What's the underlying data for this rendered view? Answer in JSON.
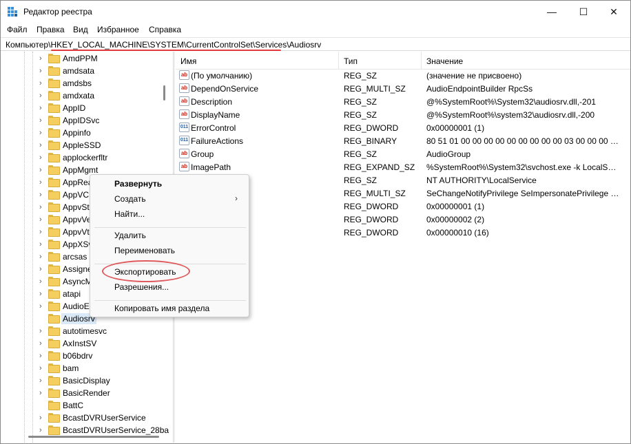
{
  "window": {
    "title": "Редактор реестра",
    "minimize": "—",
    "maximize": "☐",
    "close": "✕"
  },
  "menu": [
    "Файл",
    "Правка",
    "Вид",
    "Избранное",
    "Справка"
  ],
  "address": {
    "path": "Компьютер\\HKEY_LOCAL_MACHINE\\SYSTEM\\CurrentControlSet\\Services\\Audiosrv"
  },
  "tree": [
    {
      "label": "AmdPPM",
      "expandable": true
    },
    {
      "label": "amdsata",
      "expandable": true
    },
    {
      "label": "amdsbs",
      "expandable": true
    },
    {
      "label": "amdxata",
      "expandable": true
    },
    {
      "label": "AppID",
      "expandable": true
    },
    {
      "label": "AppIDSvc",
      "expandable": true
    },
    {
      "label": "Appinfo",
      "expandable": true
    },
    {
      "label": "AppleSSD",
      "expandable": true
    },
    {
      "label": "applockerfltr",
      "expandable": true
    },
    {
      "label": "AppMgmt",
      "expandable": true
    },
    {
      "label": "AppRea",
      "expandable": true
    },
    {
      "label": "AppVC",
      "expandable": true
    },
    {
      "label": "AppvSt",
      "expandable": true
    },
    {
      "label": "AppvVe",
      "expandable": true
    },
    {
      "label": "AppvVt",
      "expandable": true
    },
    {
      "label": "AppXSv",
      "expandable": true
    },
    {
      "label": "arcsas",
      "expandable": true
    },
    {
      "label": "Assigne",
      "expandable": true
    },
    {
      "label": "AsyncM",
      "expandable": true
    },
    {
      "label": "atapi",
      "expandable": true
    },
    {
      "label": "AudioE",
      "expandable": true
    },
    {
      "label": "Audiosrv",
      "expandable": false,
      "selected": true
    },
    {
      "label": "autotimesvc",
      "expandable": true
    },
    {
      "label": "AxInstSV",
      "expandable": true
    },
    {
      "label": "b06bdrv",
      "expandable": true
    },
    {
      "label": "bam",
      "expandable": true
    },
    {
      "label": "BasicDisplay",
      "expandable": true
    },
    {
      "label": "BasicRender",
      "expandable": true
    },
    {
      "label": "BattC",
      "expandable": false
    },
    {
      "label": "BcastDVRUserService",
      "expandable": true
    },
    {
      "label": "BcastDVRUserService_28ba",
      "expandable": true
    }
  ],
  "list": {
    "headers": {
      "name": "Имя",
      "type": "Тип",
      "data": "Значение"
    },
    "rows": [
      {
        "icon": "ab",
        "name": "(По умолчанию)",
        "type": "REG_SZ",
        "data": "(значение не присвоено)"
      },
      {
        "icon": "ab",
        "name": "DependOnService",
        "type": "REG_MULTI_SZ",
        "data": "AudioEndpointBuilder RpcSs"
      },
      {
        "icon": "ab",
        "name": "Description",
        "type": "REG_SZ",
        "data": "@%SystemRoot%\\System32\\audiosrv.dll,-201"
      },
      {
        "icon": "ab",
        "name": "DisplayName",
        "type": "REG_SZ",
        "data": "@%SystemRoot%\\system32\\audiosrv.dll,-200"
      },
      {
        "icon": "bin",
        "name": "ErrorControl",
        "type": "REG_DWORD",
        "data": "0x00000001 (1)"
      },
      {
        "icon": "bin",
        "name": "FailureActions",
        "type": "REG_BINARY",
        "data": "80 51 01 00 00 00 00 00 00 00 00 00 03 00 00 00 14 00..."
      },
      {
        "icon": "ab",
        "name": "Group",
        "type": "REG_SZ",
        "data": "AudioGroup"
      },
      {
        "icon": "ab",
        "name": "ImagePath",
        "type": "REG_EXPAND_SZ",
        "data": "%SystemRoot%\\System32\\svchost.exe -k LocalSer..."
      },
      {
        "icon": "",
        "name": "",
        "type": "REG_SZ",
        "data": "NT AUTHORITY\\LocalService"
      },
      {
        "icon": "",
        "name": "es",
        "type": "REG_MULTI_SZ",
        "data": "SeChangeNotifyPrivilege SeImpersonatePrivilege S..."
      },
      {
        "icon": "",
        "name": "",
        "type": "REG_DWORD",
        "data": "0x00000001 (1)"
      },
      {
        "icon": "",
        "name": "",
        "type": "REG_DWORD",
        "data": "0x00000002 (2)"
      },
      {
        "icon": "",
        "name": "",
        "type": "REG_DWORD",
        "data": "0x00000010 (16)"
      }
    ]
  },
  "context_menu": {
    "items": [
      {
        "label": "Развернуть",
        "bold": true,
        "name": "expand"
      },
      {
        "label": "Создать",
        "submenu": true,
        "name": "create"
      },
      {
        "label": "Найти...",
        "name": "find"
      },
      {
        "separator": true
      },
      {
        "label": "Удалить",
        "name": "delete"
      },
      {
        "label": "Переименовать",
        "name": "rename"
      },
      {
        "separator": true
      },
      {
        "label": "Экспортировать",
        "name": "export",
        "highlighted": true
      },
      {
        "label": "Разрешения...",
        "name": "permissions"
      },
      {
        "separator": true
      },
      {
        "label": "Копировать имя раздела",
        "name": "copy-key-name"
      }
    ],
    "submenu_arrow": "›"
  },
  "colors": {
    "annotation": "#e0595c",
    "selection": "#d9e9f8",
    "folder": "#f4cf5f"
  }
}
